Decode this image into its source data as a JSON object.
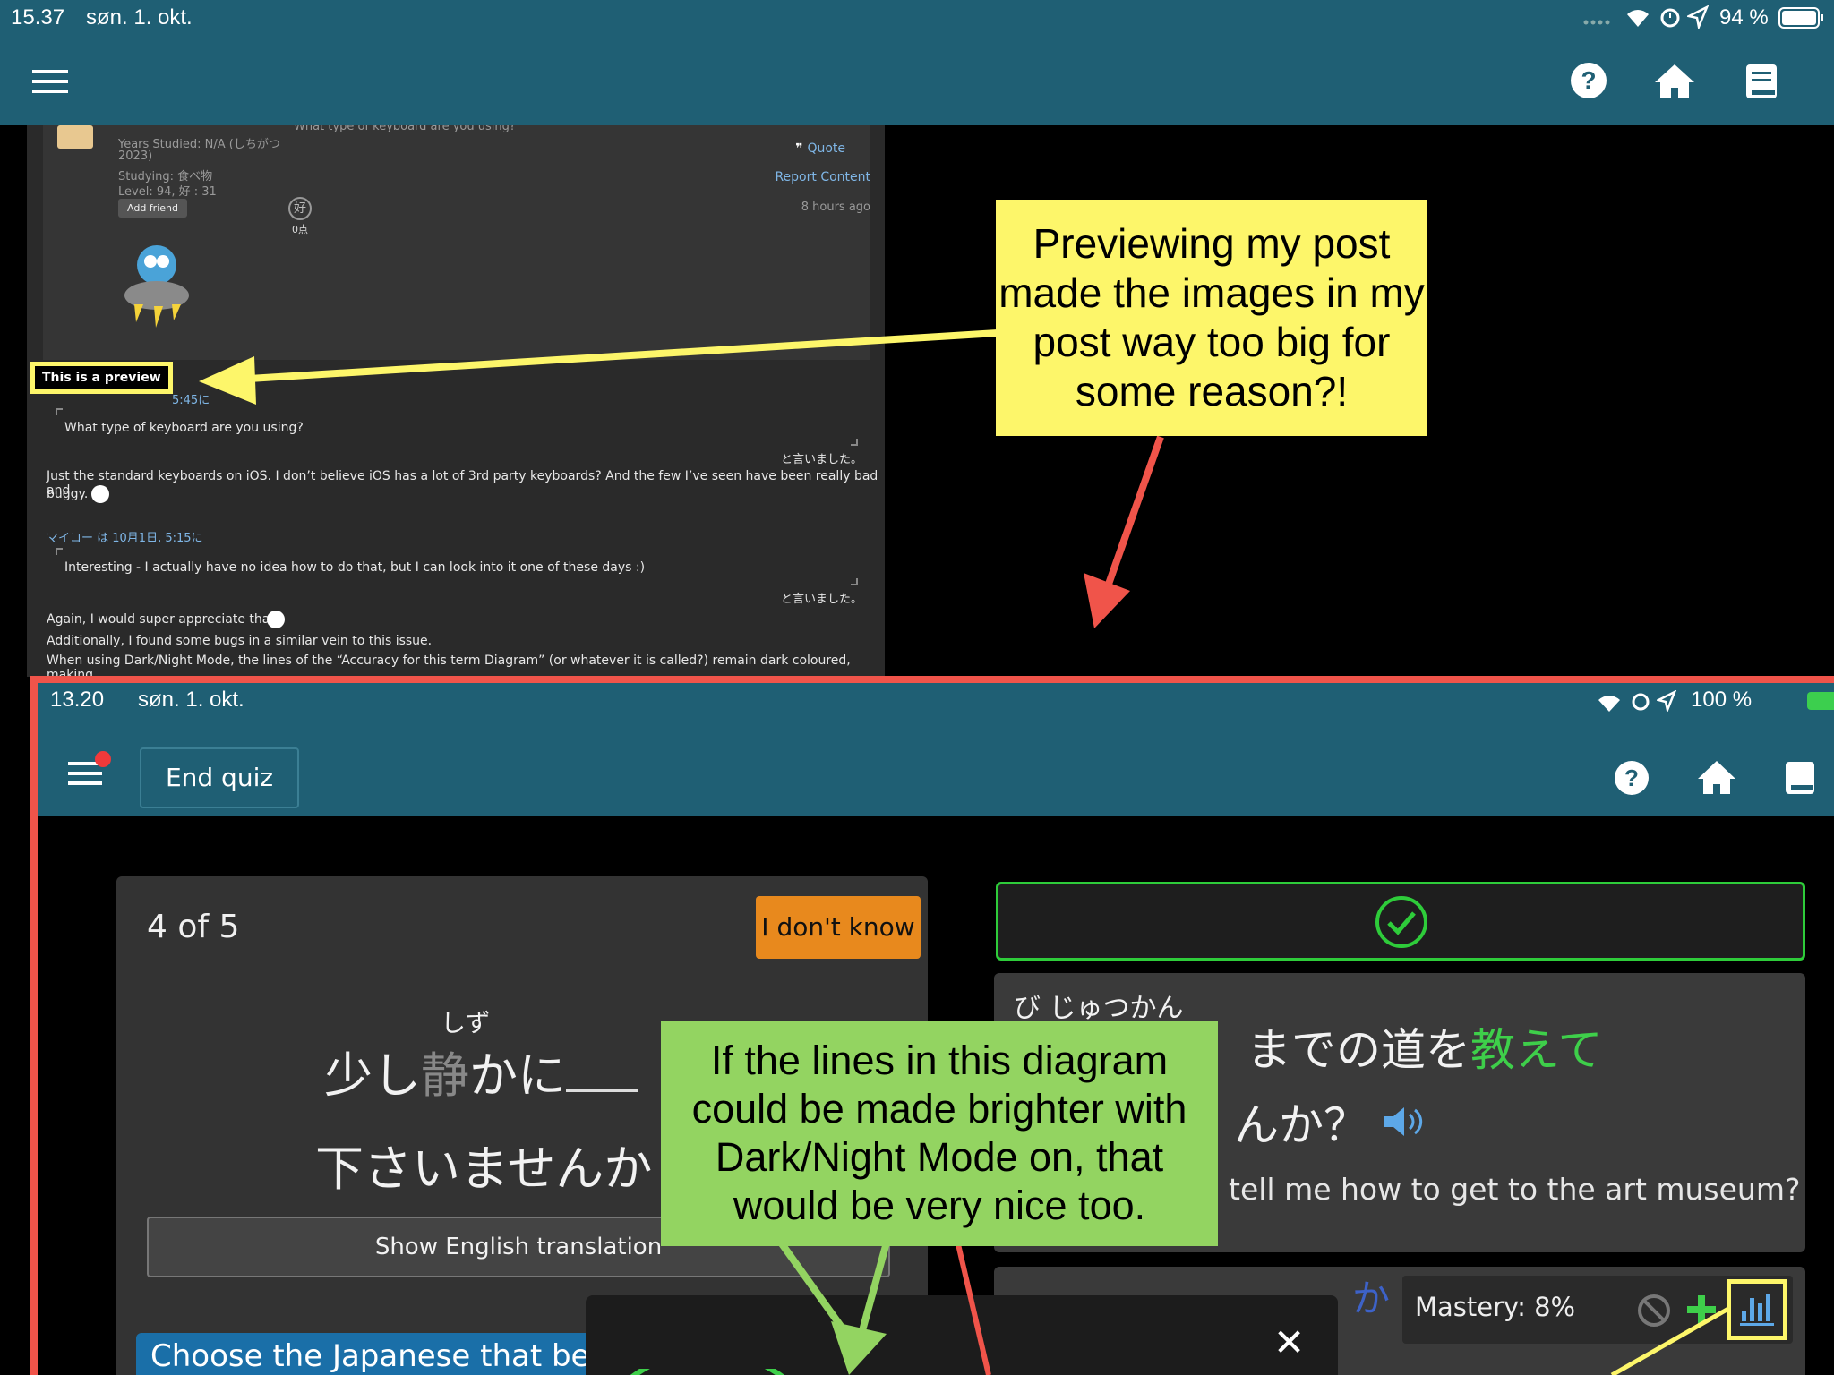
{
  "status_bar": {
    "time": "15.37",
    "date": "søn. 1. okt.",
    "battery": "94 %"
  },
  "forum": {
    "truncated_top_text": "What type of keyboard are you using?",
    "user_info": {
      "years": "Years Studied: N/A (しちがつ",
      "years_cont": "2023)",
      "studying": "Studying: 食べ物",
      "level": "Level: 94, 好 : 31",
      "add_friend": "Add friend"
    },
    "like_icon": "好",
    "points": "0点",
    "quote": "Quote",
    "report": "Report Content",
    "time_ago": "8 hours ago",
    "preview_label": "This is a preview",
    "quote1_header_tail": "5:45に",
    "quote1_text": "What type of keyboard are you using?",
    "said": "と言いました。",
    "reply1_line1": "Just the standard keyboards on iOS. I don’t believe iOS has a lot of 3rd party keyboards? And the few I’ve seen have been really bad and",
    "reply1_line2": "buggy.",
    "quote2_header": "マイコー は 10月1日, 5:15に",
    "quote2_text": "Interesting - I actually have no idea how to do that, but I can look into it one of these days :)",
    "reply2_line1": "Again, I would super appreciate that.",
    "reply2_line2": "Additionally, I found some bugs in a similar vein to this issue.",
    "reply2_line3": "When using Dark/Night Mode, the lines of the “Accuracy for this term Diagram” (or whatever it is called?) remain dark coloured, making"
  },
  "callout_yellow": "Previewing my post made the images in my post way too big for some reason?!",
  "inner": {
    "status": {
      "time": "13.20",
      "date": "søn. 1. okt.",
      "battery": "100 %"
    },
    "end_quiz": "End quiz",
    "progress": "4 of 5",
    "dont_know": "I don't know",
    "furigana": "しず",
    "question_line1_a": "少し",
    "question_line1_kanji": "静",
    "question_line1_b": "かに",
    "question_line2": "下さいませんか",
    "show_english": "Show English translation",
    "instruction": "Choose the Japanese that best",
    "answer_furigana": "び じゅつかん",
    "answer_line1": "までの道を",
    "answer_highlight": "教えて",
    "answer_line2": "んか？",
    "answer_english": "tell me how to get to the art museum?",
    "bottom_hint": "か",
    "mastery": "Mastery: 8%",
    "close": "✕"
  },
  "callout_green": "If the lines in this diagram could be made brighter with Dark/Night Mode on, that would be very nice too.",
  "colors": {
    "nav": "#1f5f74",
    "accent_red": "#f0544a",
    "yellow": "#fdf66a",
    "green": "#93d461",
    "orange": "#e8891d"
  }
}
